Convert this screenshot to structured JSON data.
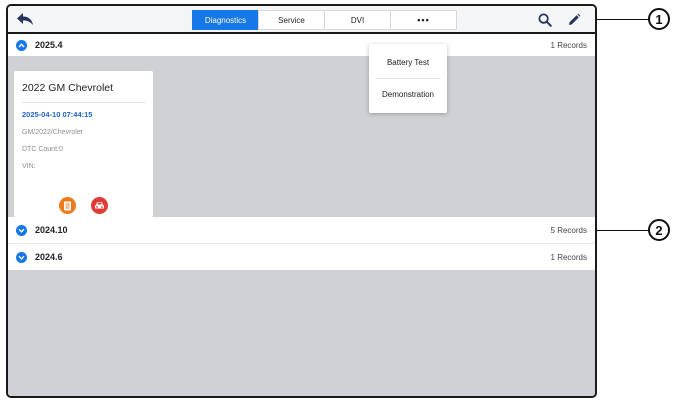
{
  "toolbar": {
    "tabs": [
      {
        "label": "Diagnostics",
        "active": true
      },
      {
        "label": "Service",
        "active": false
      },
      {
        "label": "DVI",
        "active": false
      },
      {
        "label": "•••",
        "active": false
      }
    ],
    "icons": [
      "back-arrow-icon",
      "search-icon",
      "edit-pencil-icon"
    ]
  },
  "more_menu": {
    "items": [
      "Battery Test",
      "Demonstration"
    ]
  },
  "groups": [
    {
      "title": "2025.4",
      "count": "1 Records",
      "expanded": true
    },
    {
      "title": "2024.10",
      "count": "5 Records",
      "expanded": false
    },
    {
      "title": "2024.6",
      "count": "1 Records",
      "expanded": false
    }
  ],
  "vehicle_card": {
    "title": "2022 GM Chevrolet",
    "datetime": "2025-04-10 07:44:15",
    "path": "GM/2022/Chevrolet",
    "dtc": "DTC Count:0",
    "vin": "VIN:",
    "buttons": [
      "report-icon",
      "vehicle-icon"
    ]
  },
  "callouts": [
    "1",
    "2"
  ],
  "colors": {
    "accent": "#1677e8",
    "date_text": "#1f63c9",
    "content_bg": "#cfd1d5",
    "report_button": "#ee7a1c",
    "vehicle_button": "#e23b35"
  }
}
